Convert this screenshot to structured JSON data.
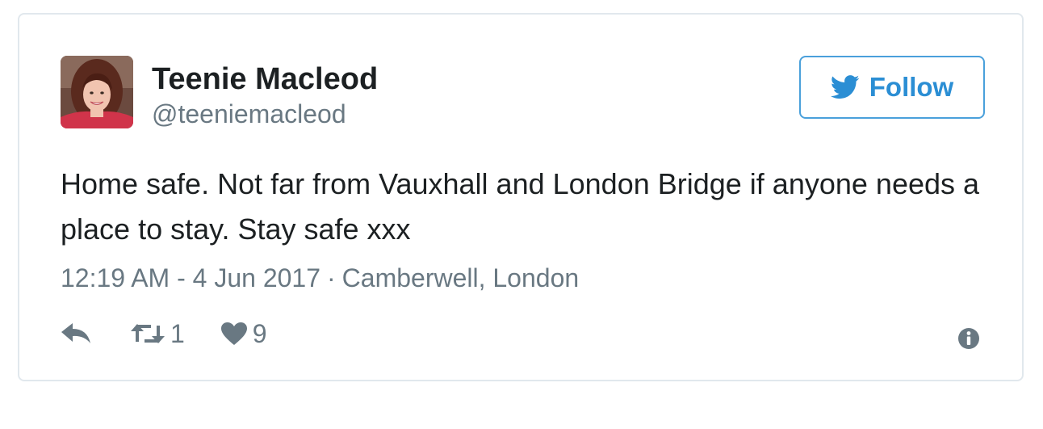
{
  "user": {
    "name": "Teenie Macleod",
    "handle": "@teeniemacleod"
  },
  "follow": {
    "label": "Follow",
    "icon": "twitter-bird-icon",
    "color": "#2b8ed4"
  },
  "tweet": {
    "text": "Home safe. Not far from Vauxhall and London Bridge if anyone needs a place to stay. Stay safe xxx",
    "time": "12:19 AM - 4 Jun 2017",
    "separator": "·",
    "location": "Camberwell, London"
  },
  "actions": {
    "reply": {
      "icon": "reply-icon"
    },
    "retweet": {
      "icon": "retweet-icon",
      "count": "1"
    },
    "like": {
      "icon": "heart-icon",
      "count": "9"
    },
    "info": {
      "icon": "info-icon"
    }
  },
  "colors": {
    "text": "#1c2022",
    "muted": "#697882",
    "border": "#e1e8ed",
    "accent": "#2b8ed4"
  }
}
